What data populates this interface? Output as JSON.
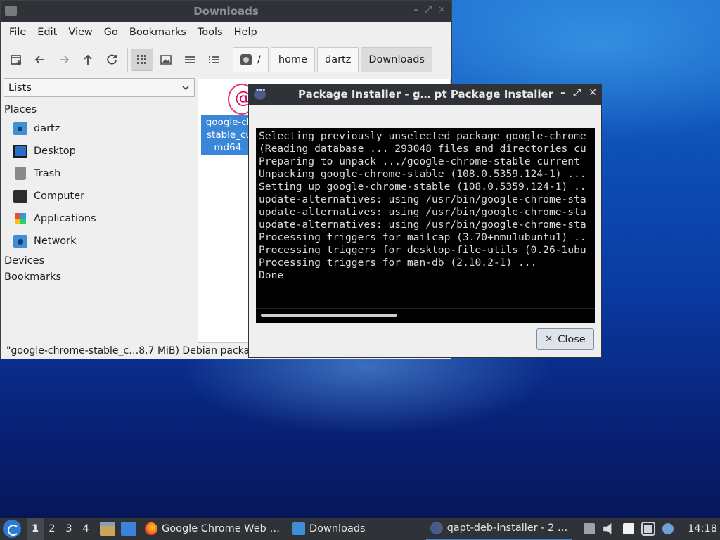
{
  "file_manager": {
    "title": "Downloads",
    "menu": [
      "File",
      "Edit",
      "View",
      "Go",
      "Bookmarks",
      "Tools",
      "Help"
    ],
    "path": [
      "/",
      "home",
      "dartz",
      "Downloads"
    ],
    "side_panel_mode": "Lists",
    "places_header": "Places",
    "places": [
      {
        "label": "dartz",
        "icon": "home-folder-icon"
      },
      {
        "label": "Desktop",
        "icon": "desktop-icon"
      },
      {
        "label": "Trash",
        "icon": "trash-icon"
      },
      {
        "label": "Computer",
        "icon": "computer-icon"
      },
      {
        "label": "Applications",
        "icon": "applications-icon"
      },
      {
        "label": "Network",
        "icon": "network-icon"
      }
    ],
    "devices_header": "Devices",
    "bookmarks_header": "Bookmarks",
    "file_label": "google-ch\nstable_cu\nmd64.",
    "status": "\"google-chrome-stable_c…8.7 MiB) Debian packag"
  },
  "installer": {
    "title": "Package Installer - g…  pt Package Installer",
    "log": [
      "Selecting previously unselected package google-chrome",
      "(Reading database ... 293048 files and directories cu",
      "Preparing to unpack .../google-chrome-stable_current_",
      "Unpacking google-chrome-stable (108.0.5359.124-1) ...",
      "Setting up google-chrome-stable (108.0.5359.124-1) ..",
      "update-alternatives: using /usr/bin/google-chrome-sta",
      "update-alternatives: using /usr/bin/google-chrome-sta",
      "update-alternatives: using /usr/bin/google-chrome-sta",
      "Processing triggers for mailcap (3.70+nmu1ubuntu1) ..",
      "Processing triggers for desktop-file-utils (0.26-1ubu",
      "Processing triggers for man-db (2.10.2-1) ...",
      "Done"
    ],
    "close_label": "Close"
  },
  "taskbar": {
    "workspaces": [
      "1",
      "2",
      "3",
      "4"
    ],
    "tasks": [
      {
        "label": "Google Chrome Web …",
        "icon": "firefox-icon"
      },
      {
        "label": "Downloads",
        "icon": "folder-icon"
      },
      {
        "label": "qapt-deb-installer - 2 …",
        "icon": "qapt-icon"
      }
    ],
    "clock": "14:18"
  }
}
